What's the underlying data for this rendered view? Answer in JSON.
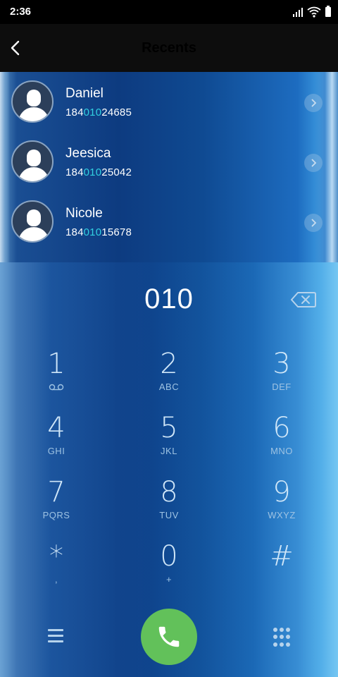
{
  "status_bar": {
    "time": "2:36"
  },
  "app_bar": {
    "title": "Recents"
  },
  "contacts": [
    {
      "name": "Daniel",
      "number_prefix": "184",
      "number_match": "010",
      "number_suffix": "24685"
    },
    {
      "name": "Jeesica",
      "number_prefix": "184",
      "number_match": "010",
      "number_suffix": "25042"
    },
    {
      "name": "Nicole",
      "number_prefix": "184",
      "number_match": "010",
      "number_suffix": "15678"
    }
  ],
  "dialer": {
    "dialed": "010",
    "keys": [
      {
        "digit": "1",
        "letters": "",
        "icon": "voicemail-icon"
      },
      {
        "digit": "2",
        "letters": "ABC"
      },
      {
        "digit": "3",
        "letters": "DEF"
      },
      {
        "digit": "4",
        "letters": "GHI"
      },
      {
        "digit": "5",
        "letters": "JKL"
      },
      {
        "digit": "6",
        "letters": "MNO"
      },
      {
        "digit": "7",
        "letters": "PQRS"
      },
      {
        "digit": "8",
        "letters": "TUV"
      },
      {
        "digit": "9",
        "letters": "WXYZ"
      },
      {
        "digit": "*",
        "letters": ","
      },
      {
        "digit": "0",
        "letters": "+"
      },
      {
        "digit": "#",
        "letters": ""
      }
    ]
  },
  "colors": {
    "match_highlight": "#31d0e0",
    "call_button": "#62c15a"
  }
}
